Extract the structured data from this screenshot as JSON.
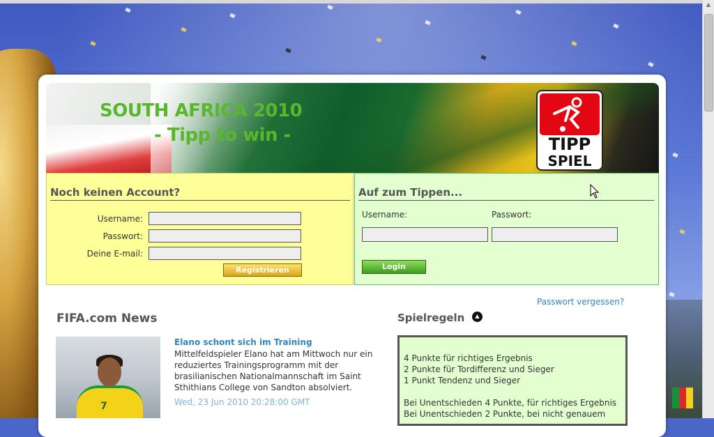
{
  "banner": {
    "title": "SOUTH AFRICA 2010",
    "subtitle": "- Tipp to win -",
    "logo_line1": "TIPP",
    "logo_line2": "SPIEL"
  },
  "register": {
    "title": "Noch keinen Account?",
    "username_label": "Username:",
    "password_label": "Passwort:",
    "email_label": "Deine E-mail:",
    "username_value": "",
    "password_value": "",
    "email_value": "",
    "button_label": "Registrieren"
  },
  "login": {
    "title": "Auf zum Tippen...",
    "username_label": "Username:",
    "password_label": "Passwort:",
    "username_value": "",
    "password_value": "",
    "button_label": "Login"
  },
  "forgot_password": "Passwort vergessen?",
  "news": {
    "title": "FIFA.com News",
    "headline": "Elano schont sich im Training",
    "body": "Mittelfeldspieler Elano hat am Mittwoch nur ein reduziertes Trainingsprogramm mit der brasilianischen Nationalmannschaft im Saint Sthithians College von Sandton absolviert.",
    "date": "Wed, 23 Jun 2010 20:28:00 GMT",
    "photo_number": "7"
  },
  "rules": {
    "title": "Spielregeln",
    "lines": [
      "4 Punkte für richtiges Ergebnis",
      "2 Punkte für Tordifferenz und Sieger",
      "1 Punkt Tendenz und Sieger",
      "",
      "Bei Unentschieden 4 Punkte, für richtiges Ergebnis",
      "Bei Unentschieden 2 Punkte, bei nicht genauem"
    ]
  },
  "colors": {
    "accent_green": "#5ab62d",
    "link_blue": "#2e86c1",
    "register_bg": "#ffff99",
    "login_bg": "#e3ffd0"
  }
}
